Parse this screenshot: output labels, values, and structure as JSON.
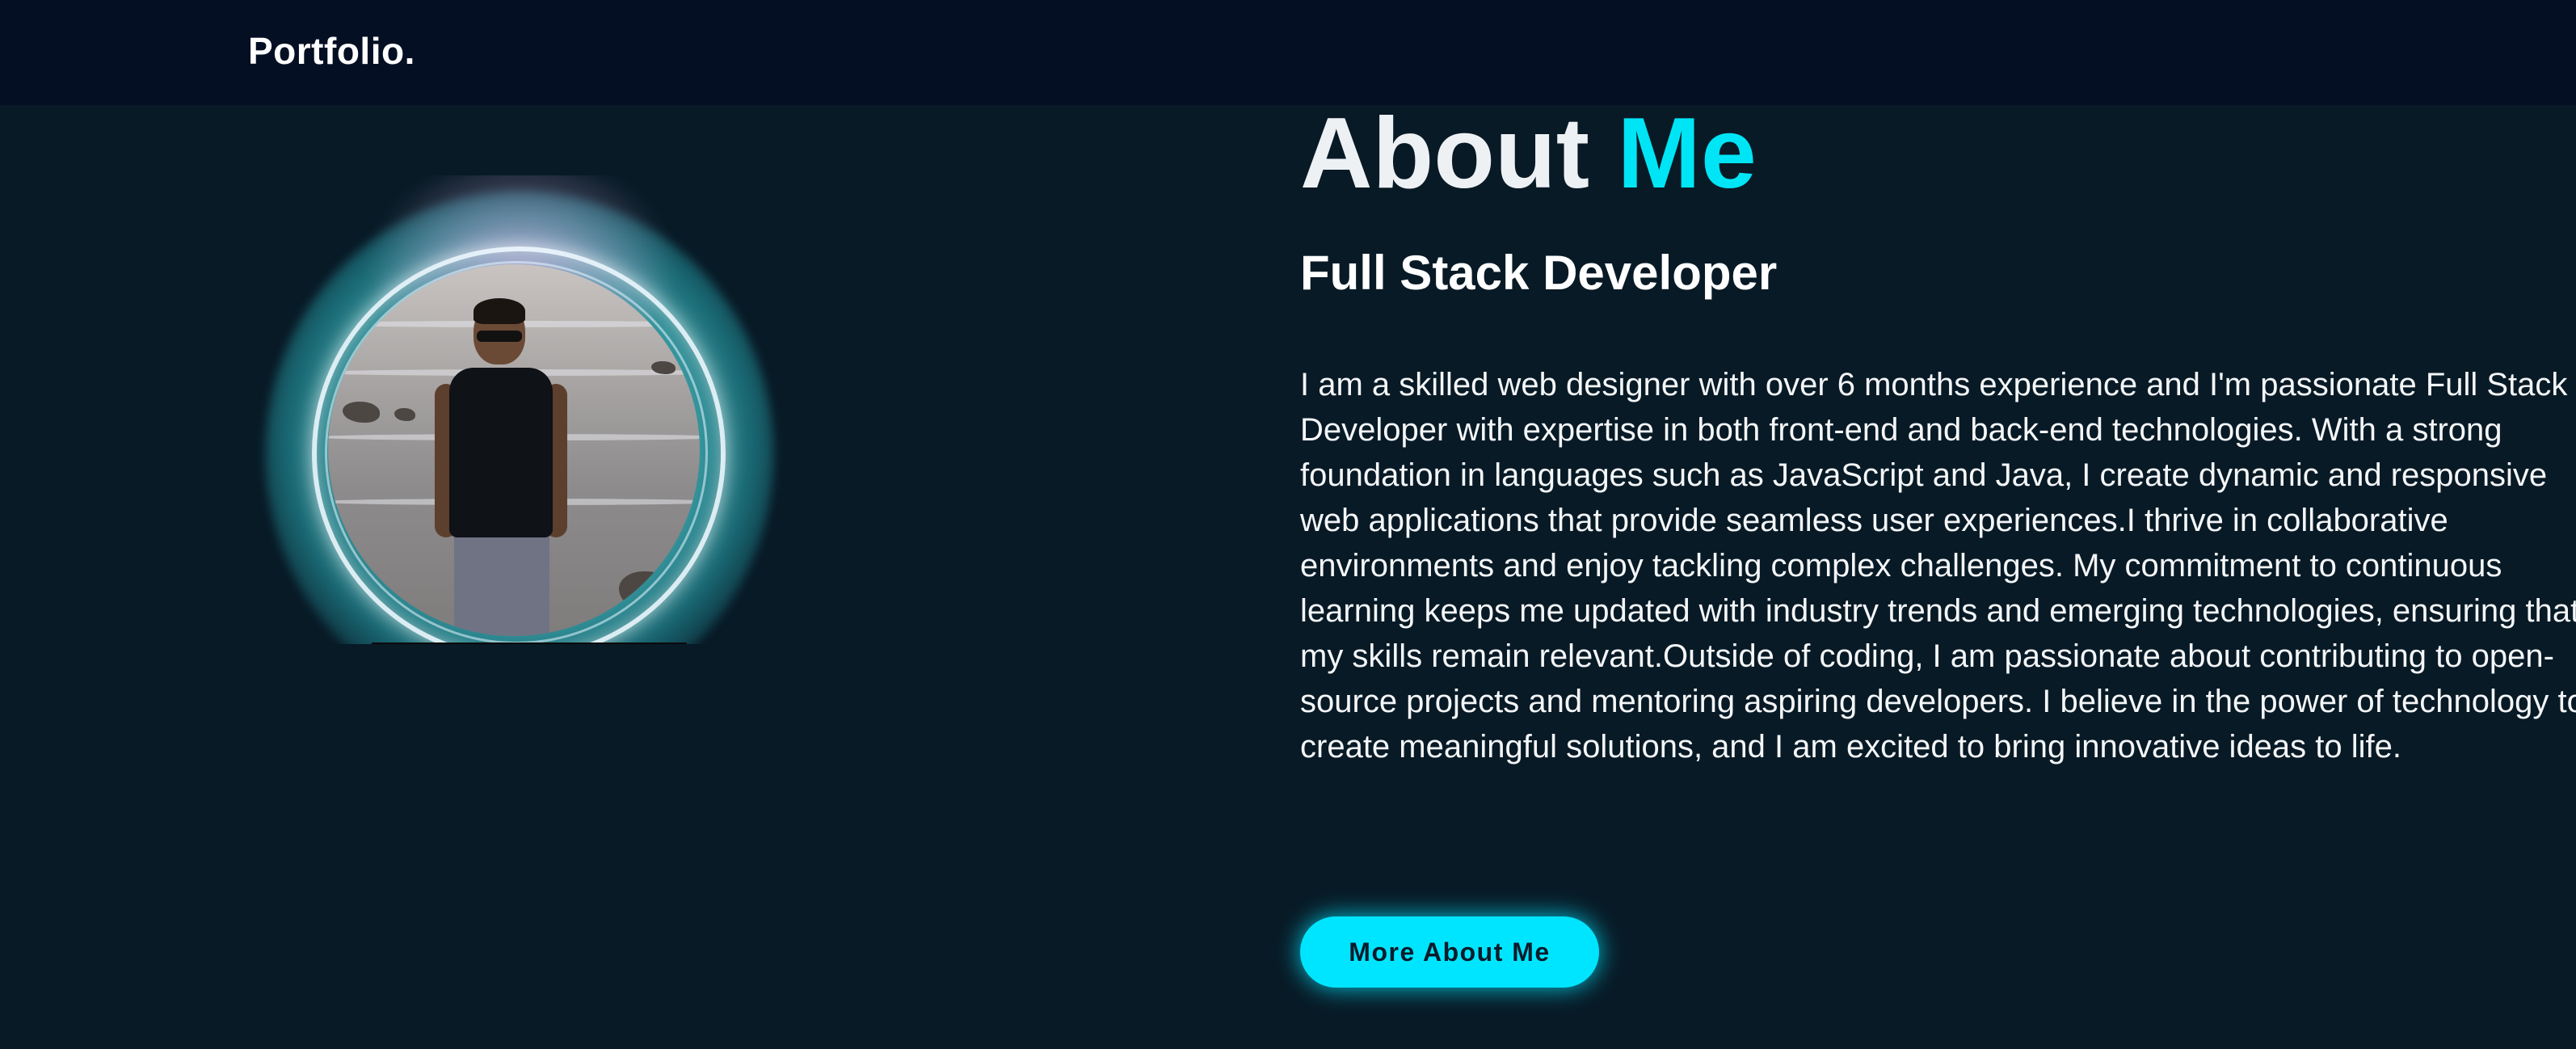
{
  "header": {
    "logo": "Portfolio."
  },
  "about": {
    "title_main": "About",
    "title_accent": "Me",
    "subtitle": "Full Stack Developer",
    "description": "I am a skilled web designer with over 6 months experience and I'm passionate Full Stack Developer with expertise in both front-end and back-end technologies. With a strong foundation in languages such as JavaScript and Java, I create dynamic and responsive web applications that provide seamless user experiences.I thrive in collaborative environments and enjoy tackling complex challenges. My commitment to continuous learning keeps me updated with industry trends and emerging technologies, ensuring that my skills remain relevant.Outside of coding, I am passionate about contributing to open-source projects and mentoring aspiring developers. I believe in the power of technology to create meaningful solutions, and I am excited to bring innovative ideas to life.",
    "button_label": "More About Me"
  },
  "colors": {
    "background": "#081a26",
    "header_background": "#050f24",
    "accent": "#00e5f5",
    "button": "#00e5ff"
  }
}
